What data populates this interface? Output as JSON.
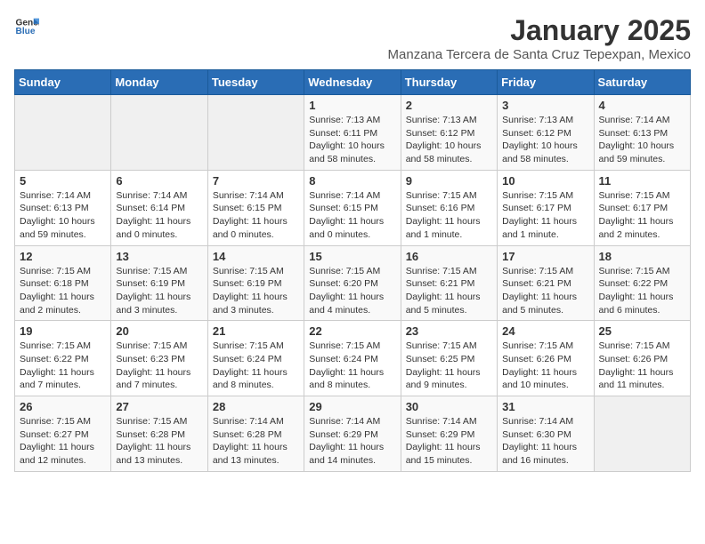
{
  "header": {
    "logo_general": "General",
    "logo_blue": "Blue",
    "title": "January 2025",
    "subtitle": "Manzana Tercera de Santa Cruz Tepexpan, Mexico"
  },
  "days_of_week": [
    "Sunday",
    "Monday",
    "Tuesday",
    "Wednesday",
    "Thursday",
    "Friday",
    "Saturday"
  ],
  "weeks": [
    [
      {
        "day": "",
        "info": ""
      },
      {
        "day": "",
        "info": ""
      },
      {
        "day": "",
        "info": ""
      },
      {
        "day": "1",
        "info": "Sunrise: 7:13 AM\nSunset: 6:11 PM\nDaylight: 10 hours and 58 minutes."
      },
      {
        "day": "2",
        "info": "Sunrise: 7:13 AM\nSunset: 6:12 PM\nDaylight: 10 hours and 58 minutes."
      },
      {
        "day": "3",
        "info": "Sunrise: 7:13 AM\nSunset: 6:12 PM\nDaylight: 10 hours and 58 minutes."
      },
      {
        "day": "4",
        "info": "Sunrise: 7:14 AM\nSunset: 6:13 PM\nDaylight: 10 hours and 59 minutes."
      }
    ],
    [
      {
        "day": "5",
        "info": "Sunrise: 7:14 AM\nSunset: 6:13 PM\nDaylight: 10 hours and 59 minutes."
      },
      {
        "day": "6",
        "info": "Sunrise: 7:14 AM\nSunset: 6:14 PM\nDaylight: 11 hours and 0 minutes."
      },
      {
        "day": "7",
        "info": "Sunrise: 7:14 AM\nSunset: 6:15 PM\nDaylight: 11 hours and 0 minutes."
      },
      {
        "day": "8",
        "info": "Sunrise: 7:14 AM\nSunset: 6:15 PM\nDaylight: 11 hours and 0 minutes."
      },
      {
        "day": "9",
        "info": "Sunrise: 7:15 AM\nSunset: 6:16 PM\nDaylight: 11 hours and 1 minute."
      },
      {
        "day": "10",
        "info": "Sunrise: 7:15 AM\nSunset: 6:17 PM\nDaylight: 11 hours and 1 minute."
      },
      {
        "day": "11",
        "info": "Sunrise: 7:15 AM\nSunset: 6:17 PM\nDaylight: 11 hours and 2 minutes."
      }
    ],
    [
      {
        "day": "12",
        "info": "Sunrise: 7:15 AM\nSunset: 6:18 PM\nDaylight: 11 hours and 2 minutes."
      },
      {
        "day": "13",
        "info": "Sunrise: 7:15 AM\nSunset: 6:19 PM\nDaylight: 11 hours and 3 minutes."
      },
      {
        "day": "14",
        "info": "Sunrise: 7:15 AM\nSunset: 6:19 PM\nDaylight: 11 hours and 3 minutes."
      },
      {
        "day": "15",
        "info": "Sunrise: 7:15 AM\nSunset: 6:20 PM\nDaylight: 11 hours and 4 minutes."
      },
      {
        "day": "16",
        "info": "Sunrise: 7:15 AM\nSunset: 6:21 PM\nDaylight: 11 hours and 5 minutes."
      },
      {
        "day": "17",
        "info": "Sunrise: 7:15 AM\nSunset: 6:21 PM\nDaylight: 11 hours and 5 minutes."
      },
      {
        "day": "18",
        "info": "Sunrise: 7:15 AM\nSunset: 6:22 PM\nDaylight: 11 hours and 6 minutes."
      }
    ],
    [
      {
        "day": "19",
        "info": "Sunrise: 7:15 AM\nSunset: 6:22 PM\nDaylight: 11 hours and 7 minutes."
      },
      {
        "day": "20",
        "info": "Sunrise: 7:15 AM\nSunset: 6:23 PM\nDaylight: 11 hours and 7 minutes."
      },
      {
        "day": "21",
        "info": "Sunrise: 7:15 AM\nSunset: 6:24 PM\nDaylight: 11 hours and 8 minutes."
      },
      {
        "day": "22",
        "info": "Sunrise: 7:15 AM\nSunset: 6:24 PM\nDaylight: 11 hours and 8 minutes."
      },
      {
        "day": "23",
        "info": "Sunrise: 7:15 AM\nSunset: 6:25 PM\nDaylight: 11 hours and 9 minutes."
      },
      {
        "day": "24",
        "info": "Sunrise: 7:15 AM\nSunset: 6:26 PM\nDaylight: 11 hours and 10 minutes."
      },
      {
        "day": "25",
        "info": "Sunrise: 7:15 AM\nSunset: 6:26 PM\nDaylight: 11 hours and 11 minutes."
      }
    ],
    [
      {
        "day": "26",
        "info": "Sunrise: 7:15 AM\nSunset: 6:27 PM\nDaylight: 11 hours and 12 minutes."
      },
      {
        "day": "27",
        "info": "Sunrise: 7:15 AM\nSunset: 6:28 PM\nDaylight: 11 hours and 13 minutes."
      },
      {
        "day": "28",
        "info": "Sunrise: 7:14 AM\nSunset: 6:28 PM\nDaylight: 11 hours and 13 minutes."
      },
      {
        "day": "29",
        "info": "Sunrise: 7:14 AM\nSunset: 6:29 PM\nDaylight: 11 hours and 14 minutes."
      },
      {
        "day": "30",
        "info": "Sunrise: 7:14 AM\nSunset: 6:29 PM\nDaylight: 11 hours and 15 minutes."
      },
      {
        "day": "31",
        "info": "Sunrise: 7:14 AM\nSunset: 6:30 PM\nDaylight: 11 hours and 16 minutes."
      },
      {
        "day": "",
        "info": ""
      }
    ]
  ]
}
